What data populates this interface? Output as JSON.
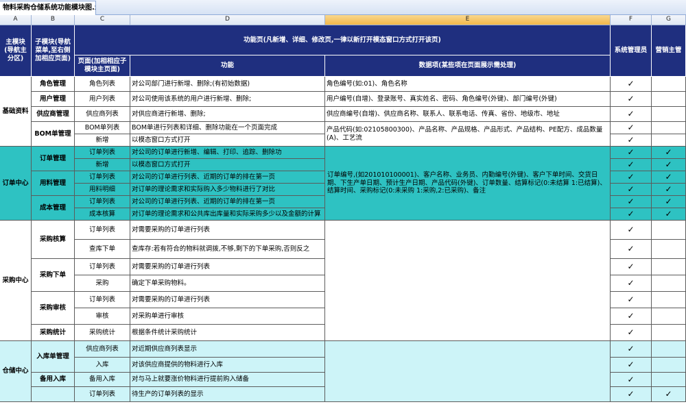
{
  "file_tab": {
    "title": "物料采购仓储系统功能模块图.xls"
  },
  "column_letters": [
    "A",
    "B",
    "C",
    "D",
    "E",
    "F",
    "G"
  ],
  "header": {
    "main_module": "主模块(导航主分区)",
    "sub_module": "子模块(导航菜单,至右侧加相应页面)",
    "function_page_group": "功能页(凡新增、详细、修改页,一律以新打开模态窗口方式打开该页)",
    "page": "页面(加相相应子模块主页面)",
    "function": "功能",
    "data_items": "数据项(某些项在页面展示需处理)",
    "sys_admin": "系统管理员",
    "sales_manager": "营销主管"
  },
  "check_mark": "✓",
  "groups": [
    {
      "name": "基础资料",
      "color": "#ffffff",
      "submodules": [
        {
          "name": "角色管理",
          "rows": [
            {
              "page": "角色列表",
              "function": "对公司部门进行新增、删除;(有初始数据)",
              "data": "角色编号(如:01)、角色名称",
              "admin": true,
              "sales": false
            }
          ]
        },
        {
          "name": "用户管理",
          "rows": [
            {
              "page": "用户列表",
              "function": "对公司使用该系统的用户进行新增、删除;",
              "data": "用户编号(自增)、登录账号、真实姓名、密码、角色编号(外键)、部门编号(外键)",
              "admin": true,
              "sales": false
            }
          ]
        },
        {
          "name": "供应商管理",
          "rows": [
            {
              "page": "供应商列表",
              "function": "对供应商进行新增、删除;",
              "data": "供应商编号(自增)、供应商名称、联系人、联系电话、传真、省份、地级市、地址",
              "admin": true,
              "sales": false
            }
          ]
        },
        {
          "name": "BOM单管理",
          "rows": [
            {
              "page": "BOM单列表",
              "function": "BOM单进行列表和详细、删除功能在一个页面完成",
              "admin": true,
              "sales": false
            },
            {
              "page": "新增",
              "function": "以模态窗口方式打开",
              "admin": true,
              "sales": false
            }
          ],
          "data": "产品代码(如:02105800300)、产品名称、产品规格、产品形式、产品结构、PE配方、成品数量(A)、工艺流"
        }
      ]
    },
    {
      "name": "订单中心",
      "color": "#2ec2c2",
      "data": "订单编号,(如201010100001)、客户名称、业务员、内勤编号(外键)、客户下单时间、交货日期、下生产单日期、预计生产日期、产品代码(外键)、订单数量、结算标记(0:未结算 1:已结算)、结算时间、采购标记(0:未采购 1:采购,2:已采购)、备注",
      "submodules": [
        {
          "name": "订单管理",
          "rows": [
            {
              "page": "订单列表",
              "function": "对公司的订单进行新增、编辑、打印、追踪、删除功",
              "admin": true,
              "sales": true
            },
            {
              "page": "新增",
              "function": "以模态窗口方式打开",
              "admin": true,
              "sales": true
            }
          ]
        },
        {
          "name": "用料管理",
          "rows": [
            {
              "page": "订单列表",
              "function": "对公司的订单进行列表、近期的订单的排在第一页",
              "admin": true,
              "sales": true
            },
            {
              "page": "用料明细",
              "function": "对订单的理论需求和实际购入多少物料进行了对比",
              "admin": true,
              "sales": true
            }
          ]
        },
        {
          "name": "成本管理",
          "rows": [
            {
              "page": "订单列表",
              "function": "对公司的订单进行列表、近期的订单的排在第一页",
              "admin": true,
              "sales": true
            },
            {
              "page": "成本核算",
              "function": "对订单的理论需求和公共库出库量和实际采购多少以及金额的计算",
              "admin": true,
              "sales": true
            }
          ]
        }
      ]
    },
    {
      "name": "采购中心",
      "color": "#ffffff",
      "data": "",
      "submodules": [
        {
          "name": "采购核算",
          "rows": [
            {
              "page": "订单列表",
              "function": "对需要采购的订单进行列表",
              "admin": true,
              "sales": false
            },
            {
              "page": "查库下单",
              "function": "查库存:若有符合的物料就调拨,不够,剩下的下单采购,否则反之",
              "admin": true,
              "sales": false
            }
          ]
        },
        {
          "name": "采购下单",
          "rows": [
            {
              "page": "订单列表",
              "function": "对需要采购的订单进行列表",
              "admin": true,
              "sales": false
            },
            {
              "page": "采购",
              "function": "确定下单采购物料。",
              "admin": true,
              "sales": false
            }
          ]
        },
        {
          "name": "采购审核",
          "rows": [
            {
              "page": "订单列表",
              "function": "对需要采购的订单进行列表",
              "admin": true,
              "sales": false
            },
            {
              "page": "审核",
              "function": "对采购单进行审核",
              "admin": true,
              "sales": false
            }
          ]
        },
        {
          "name": "采购统计",
          "rows": [
            {
              "page": "采购统计",
              "function": "根据条件统计采购统计",
              "admin": true,
              "sales": false
            }
          ]
        }
      ]
    },
    {
      "name": "仓储中心",
      "color": "#cdf4f8",
      "data": "",
      "submodules": [
        {
          "name": "入库单管理",
          "rows": [
            {
              "page": "供应商列表",
              "function": "对近期供应商列表显示",
              "admin": true,
              "sales": false
            },
            {
              "page": "入库",
              "function": "对该供应商提供的物料进行入库",
              "admin": true,
              "sales": false
            }
          ]
        },
        {
          "name": "备用入库",
          "rows": [
            {
              "page": "备用入库",
              "function": "对与马上就要涨价物料进行提前购入储备",
              "admin": true,
              "sales": false
            }
          ]
        },
        {
          "name": "",
          "rows": [
            {
              "page": "订单列表",
              "function": "待生产的订单列表的显示",
              "admin": true,
              "sales": true
            }
          ]
        }
      ]
    }
  ]
}
